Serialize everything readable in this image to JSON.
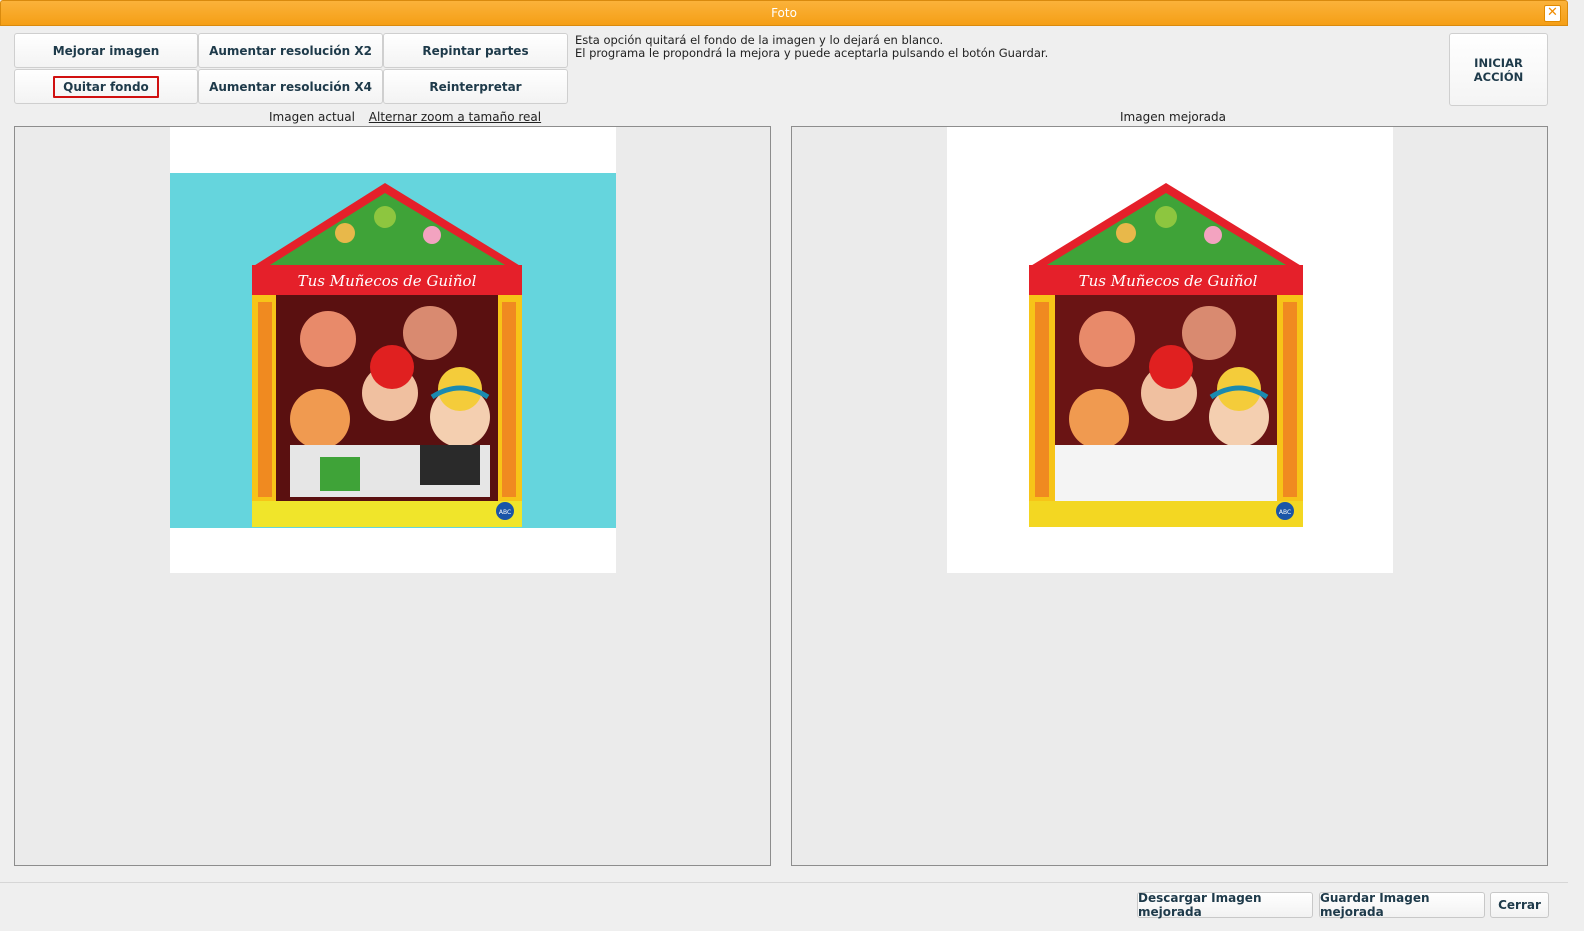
{
  "window": {
    "title": "Foto",
    "close_symbol": "✕"
  },
  "toolbar": {
    "buttons": [
      {
        "label": "Mejorar imagen"
      },
      {
        "label": "Aumentar resolución X2"
      },
      {
        "label": "Repintar partes"
      },
      {
        "label": "Quitar fondo",
        "selected": true
      },
      {
        "label": "Aumentar resolución X4"
      },
      {
        "label": "Reinterpretar"
      }
    ],
    "description_line1": "Esta opción quitará el fondo de la imagen y lo dejará en blanco.",
    "description_line2": "El programa le propondrá la mejora y puede aceptarla pulsando el botón Guardar.",
    "start_line1": "INICIAR",
    "start_line2": "ACCIÓN"
  },
  "left_panel": {
    "caption": "Imagen actual",
    "zoom_link": "Alternar zoom a tamaño real",
    "box_title": "Tus Muñecos de Guiñol",
    "badge": "ABC"
  },
  "right_panel": {
    "caption": "Imagen mejorada",
    "box_title": "Tus Muñecos de Guiñol",
    "badge": "ABC"
  },
  "footer": {
    "download_label": "Descargar Imagen mejorada",
    "save_label": "Guardar Imagen mejorada",
    "close_label": "Cerrar"
  },
  "colors": {
    "titlebar": "#f7a826",
    "selected_border": "#d01010",
    "photo_background": "#58cfd9"
  }
}
